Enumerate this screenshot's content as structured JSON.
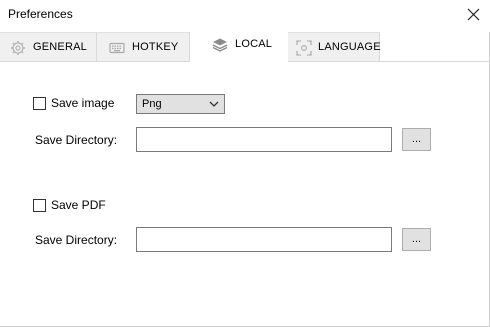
{
  "window": {
    "title": "Preferences"
  },
  "tabs": [
    {
      "label": "GENERAL",
      "icon": "gear-icon",
      "active": false
    },
    {
      "label": "HOTKEY",
      "icon": "keyboard-icon",
      "active": false
    },
    {
      "label": "LOCAL",
      "icon": "layers-icon",
      "active": true
    },
    {
      "label": "LANGUAGE",
      "icon": "language-icon",
      "active": false
    }
  ],
  "local": {
    "image": {
      "checkbox_label": "Save image",
      "checked": false,
      "format_selected": "Png",
      "directory_label": "Save Directory:",
      "directory_value": "",
      "browse_label": "..."
    },
    "pdf": {
      "checkbox_label": "Save PDF",
      "checked": false,
      "directory_label": "Save Directory:",
      "directory_value": "",
      "browse_label": "..."
    }
  },
  "colors": {
    "tab_inactive_bg": "#f0f0f0",
    "control_bg": "#e1e1e1",
    "border": "#7a7a7a"
  }
}
